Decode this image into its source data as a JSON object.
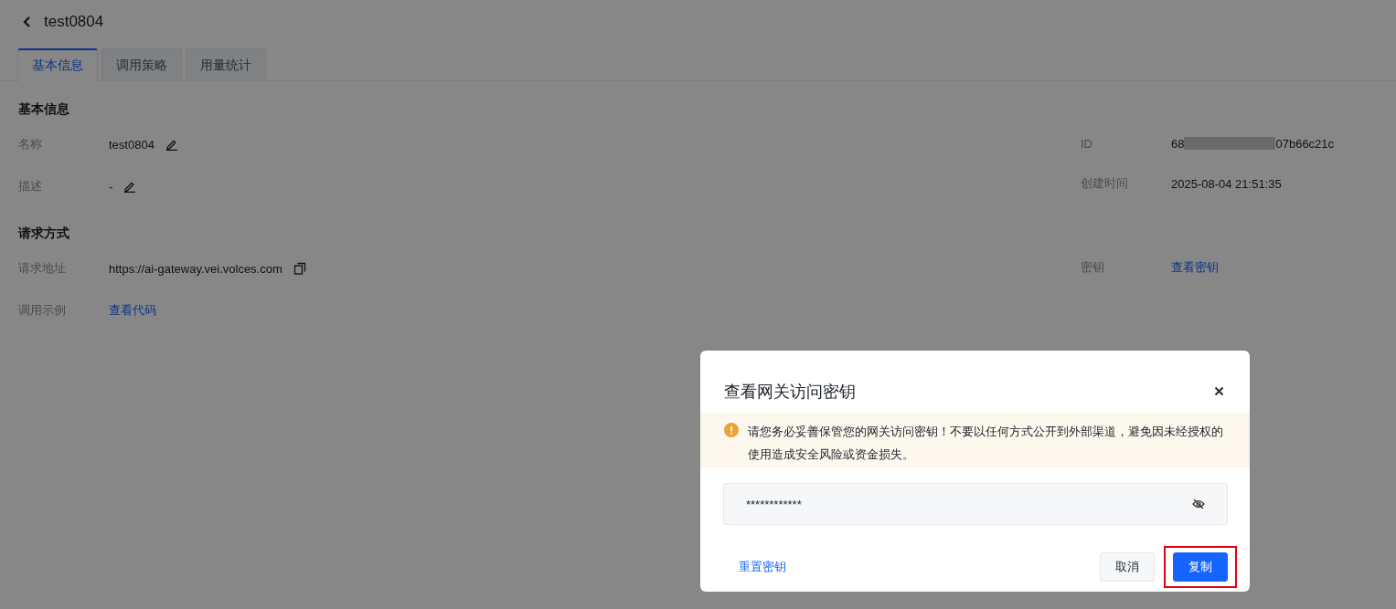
{
  "page": {
    "title": "test0804"
  },
  "tabs": [
    {
      "label": "基本信息",
      "selected": true
    },
    {
      "label": "调用策略",
      "selected": false
    },
    {
      "label": "用量统计",
      "selected": false
    }
  ],
  "sections": [
    {
      "title": "基本信息",
      "left": [
        {
          "label": "名称",
          "value": "test0804",
          "kind": "editable"
        },
        {
          "label": "描述",
          "value": "-",
          "kind": "editable"
        }
      ],
      "right": [
        {
          "label": "ID",
          "value": "68",
          "value_end": "07b66c21c",
          "kind": "redacted"
        },
        {
          "label": "创建时间",
          "value": "2025-08-04 21:51:35",
          "kind": "text"
        }
      ]
    },
    {
      "title": "请求方式",
      "left": [
        {
          "label": "请求地址",
          "value": "https://ai-gateway.vei.volces.com",
          "kind": "copyable"
        },
        {
          "label": "调用示例",
          "value": "查看代码",
          "kind": "link"
        }
      ],
      "right": [
        {
          "label": "密钥",
          "value": "查看密钥",
          "kind": "link"
        }
      ]
    }
  ],
  "modal": {
    "title": "查看网关访问密钥",
    "warning": "请您务必妥善保管您的网关访问密钥！不要以任何方式公开到外部渠道，避免因未经授权的使用造成安全风险或资金损失。",
    "secret": "************",
    "secret_hidden": true,
    "reset_link": "重置密钥",
    "buttons": [
      {
        "label": "取消",
        "kind": "secondary",
        "highlighted": false
      },
      {
        "label": "复制",
        "kind": "primary",
        "highlighted": true
      }
    ]
  }
}
